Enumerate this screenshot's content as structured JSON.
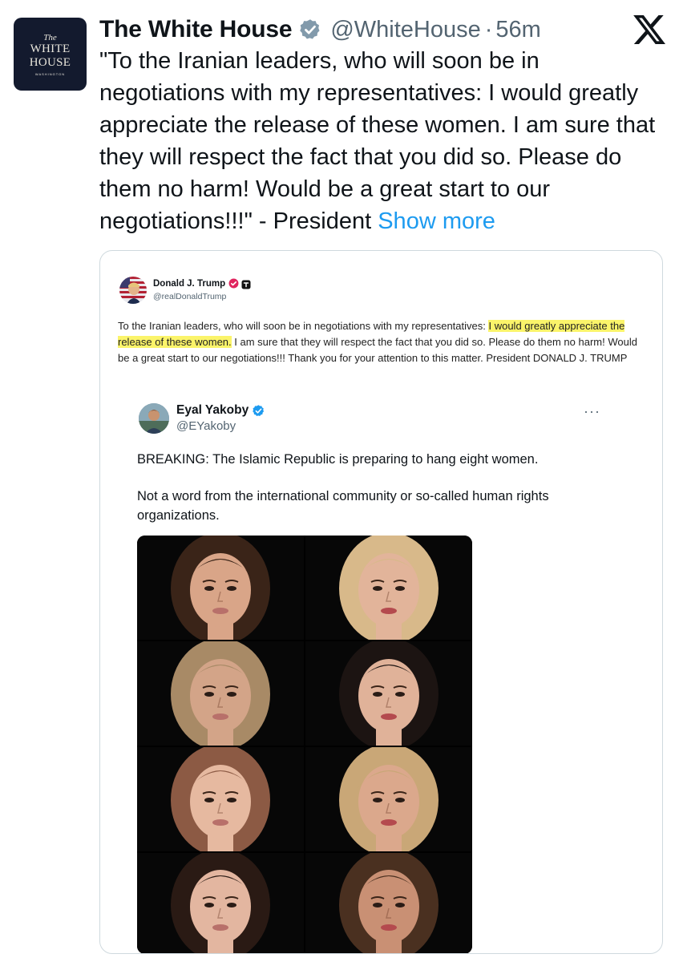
{
  "post": {
    "author": {
      "display_name": "The White House",
      "handle": "@WhiteHouse",
      "separator": "·",
      "age": "56m",
      "avatar": {
        "the": "The",
        "line1": "WHITE",
        "line2": "HOUSE",
        "small": "WASHINGTON"
      },
      "badge_icon": "gray-verified-badge-icon"
    },
    "text": "\"To the Iranian leaders, who will soon be in negotiations with my representatives: I would greatly appreciate the release of these women. I am sure that they will respect the fact that you did so. Please do them no harm! Would be a great start to our negotiations!!!\" - President",
    "show_more_label": "Show more",
    "platform_icon": "x-logo-icon"
  },
  "embedded_post": {
    "author": {
      "display_name": "Donald J. Trump",
      "handle": "@realDonaldTrump"
    },
    "text_before": "To the Iranian leaders, who will soon be in negotiations with my representatives: ",
    "text_highlighted": "I would greatly appreciate the release of these women.",
    "text_after": " I am sure that they will respect the fact that you did so. Please do them no harm! Would be a great start to our negotiations!!! Thank you for your attention to this matter. President DONALD J. TRUMP",
    "highlight_color": "#fbf46a"
  },
  "quoted_post": {
    "author": {
      "display_name": "Eyal Yakoby",
      "handle": "@EYakoby"
    },
    "more_label": "···",
    "paragraphs": [
      "BREAKING: The Islamic Republic is preparing to hang eight women.",
      "Not a word from the international community or so-called human rights organizations."
    ],
    "photos": [
      {
        "hair": "#3a2418",
        "skin": "#d9a588"
      },
      {
        "hair": "#d8b98a",
        "skin": "#e2b49a"
      },
      {
        "hair": "#a88a66",
        "skin": "#d3a488"
      },
      {
        "hair": "#1c1412",
        "skin": "#e0b299"
      },
      {
        "hair": "#8c5a44",
        "skin": "#e6b9a0"
      },
      {
        "hair": "#c9a777",
        "skin": "#dba88c"
      },
      {
        "hair": "#2a1a14",
        "skin": "#e3b6a0"
      },
      {
        "hair": "#4a3020",
        "skin": "#c99074"
      }
    ]
  },
  "colors": {
    "link": "#1d9bf0",
    "muted": "#536471",
    "verified_blue": "#1d9bf0",
    "verified_gray": "#829aab",
    "avatar_bg": "#131a2e"
  }
}
